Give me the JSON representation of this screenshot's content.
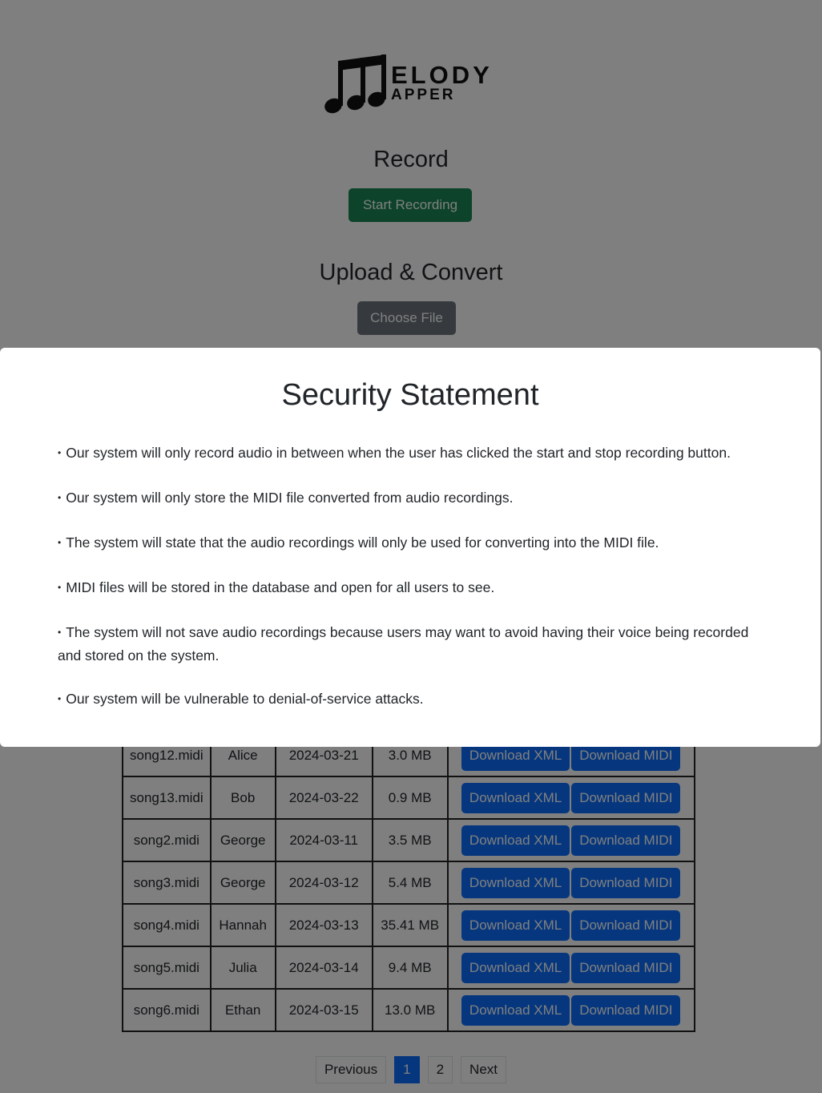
{
  "logo": {
    "text_line1": "ELODY",
    "text_line2": "APPER"
  },
  "record": {
    "heading": "Record",
    "button": "Start Recording"
  },
  "upload": {
    "heading": "Upload & Convert",
    "button": "Choose File"
  },
  "modal": {
    "title": "Security Statement",
    "items": [
      "Our system will only record audio in between when the user has clicked the start and stop recording button.",
      "Our system will only store the MIDI file converted from audio recordings.",
      "The system will state that the audio recordings will only be used for converting into the MIDI file.",
      "MIDI files will be stored in the database and open for all users to see.",
      "The system will not save audio recordings because users may want to avoid having their voice being recorded and stored on the system.",
      "Our system will be vulnerable to denial-of-service attacks."
    ]
  },
  "table": {
    "rows": [
      {
        "name": "song12.midi",
        "user": "Alice",
        "date": "2024-03-21",
        "size": "3.0 MB",
        "xml": "Download XML",
        "midi": "Download MIDI"
      },
      {
        "name": "song13.midi",
        "user": "Bob",
        "date": "2024-03-22",
        "size": "0.9 MB",
        "xml": "Download XML",
        "midi": "Download MIDI"
      },
      {
        "name": "song2.midi",
        "user": "George",
        "date": "2024-03-11",
        "size": "3.5 MB",
        "xml": "Download XML",
        "midi": "Download MIDI"
      },
      {
        "name": "song3.midi",
        "user": "George",
        "date": "2024-03-12",
        "size": "5.4 MB",
        "xml": "Download XML",
        "midi": "Download MIDI"
      },
      {
        "name": "song4.midi",
        "user": "Hannah",
        "date": "2024-03-13",
        "size": "35.41 MB",
        "xml": "Download XML",
        "midi": "Download MIDI"
      },
      {
        "name": "song5.midi",
        "user": "Julia",
        "date": "2024-03-14",
        "size": "9.4 MB",
        "xml": "Download XML",
        "midi": "Download MIDI"
      },
      {
        "name": "song6.midi",
        "user": "Ethan",
        "date": "2024-03-15",
        "size": "13.0 MB",
        "xml": "Download XML",
        "midi": "Download MIDI"
      }
    ]
  },
  "pagination": {
    "previous": "Previous",
    "page1": "1",
    "page2": "2",
    "next": "Next"
  },
  "colors": {
    "primary": "#0d6efd",
    "success": "#198754",
    "secondary": "#6c757d",
    "backdrop": "rgba(0,0,0,0.5)"
  }
}
